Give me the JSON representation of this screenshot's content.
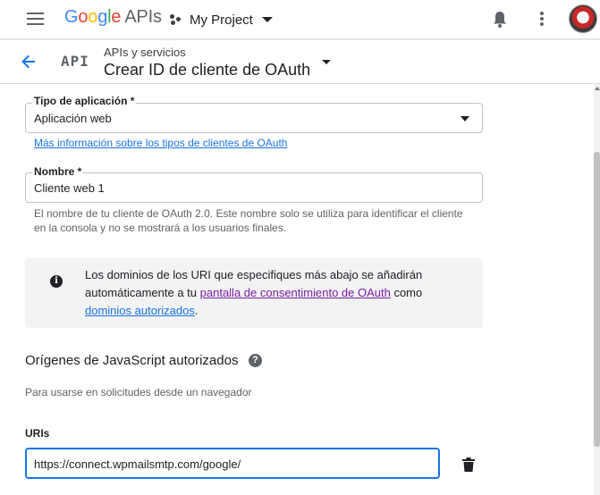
{
  "topbar": {
    "logo_google": [
      "G",
      "o",
      "o",
      "g",
      "l",
      "e"
    ],
    "logo_apis": "APIs",
    "project_name": "My Project"
  },
  "subheader": {
    "api_badge": "API",
    "breadcrumb": "APIs y servicios",
    "title": "Crear ID de cliente de OAuth"
  },
  "form": {
    "app_type": {
      "label": "Tipo de aplicación *",
      "value": "Aplicación web",
      "help_link": "Más información sobre los tipos de clientes de OAuth"
    },
    "name": {
      "label": "Nombre *",
      "value": "Cliente web 1",
      "help_line1": "El nombre de tu cliente de OAuth 2.0. Este nombre solo se utiliza para identificar el cliente",
      "help_line2": "en la consola y no se mostrará a los usuarios finales."
    },
    "info": {
      "text_part1": "Los dominios de los URI que especifiques más abajo se añadirán automáticamente a tu ",
      "consent_link": "pantalla de consentimiento de OAuth",
      "text_part2": " como ",
      "domains_link": "dominios autorizados",
      "text_part3": "."
    },
    "js_origins": {
      "title": "Orígenes de JavaScript autorizados",
      "description": "Para usarse en solicitudes desde un navegador",
      "uris_label": "URIs",
      "uri_value": "https://connect.wpmailsmtp.com/google/"
    }
  },
  "colors": {
    "accent": "#1a73e8",
    "visited_link": "#7b1fa2",
    "info_bg": "#f1f3f4"
  },
  "icons": [
    "menu-icon",
    "project-icon",
    "bell-icon",
    "more-vert-icon",
    "back-arrow-icon",
    "info-icon",
    "help-icon",
    "delete-icon"
  ]
}
